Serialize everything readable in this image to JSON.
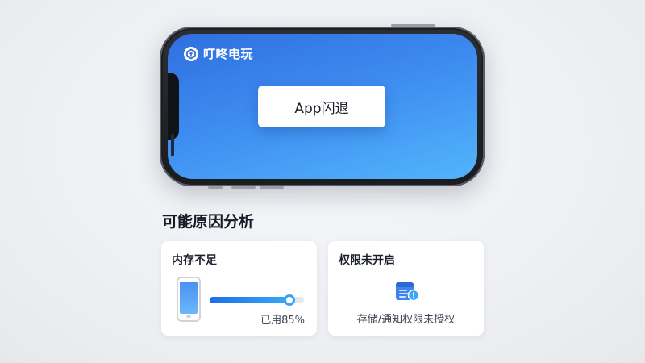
{
  "phone": {
    "brand_name": "叮咚电玩",
    "crash_label": "App闪退"
  },
  "analysis": {
    "title": "可能原因分析",
    "memory": {
      "title": "内存不足",
      "usage_percent": 85,
      "usage_text": "已用85%"
    },
    "permission": {
      "title": "权限未开启",
      "description": "存储/通知权限未授权"
    }
  },
  "icons": {
    "brand_logo": "brand-logo-icon",
    "mini_phone": "phone-icon",
    "permission": "storage-notification-icon"
  },
  "colors": {
    "accent": "#2f6fe0",
    "accent_light": "#52b4fb"
  }
}
